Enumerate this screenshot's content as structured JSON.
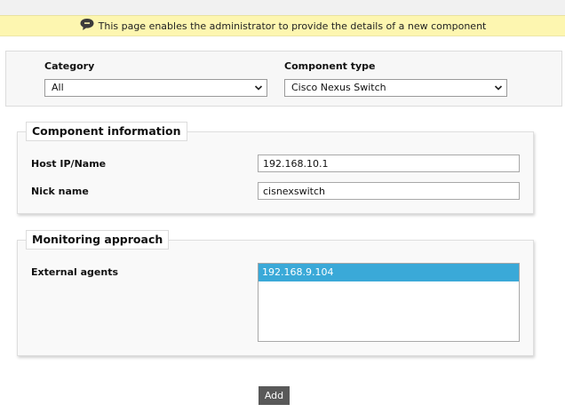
{
  "banner": {
    "text": "This page enables the administrator to provide the details of a new component"
  },
  "filters": {
    "category": {
      "label": "Category",
      "value": "All"
    },
    "component_type": {
      "label": "Component type",
      "value": "Cisco Nexus Switch"
    }
  },
  "component_info": {
    "legend": "Component information",
    "host": {
      "label": "Host IP/Name",
      "value": "192.168.10.1"
    },
    "nick": {
      "label": "Nick name",
      "value": "cisnexswitch"
    }
  },
  "monitoring": {
    "legend": "Monitoring approach",
    "external_agents": {
      "label": "External agents",
      "options": [
        "192.168.9.104"
      ],
      "selected": "192.168.9.104"
    }
  },
  "actions": {
    "add_label": "Add"
  },
  "colors": {
    "banner_bg": "#fdf6b0",
    "selection": "#3aa9d8",
    "button_bg": "#595959"
  }
}
